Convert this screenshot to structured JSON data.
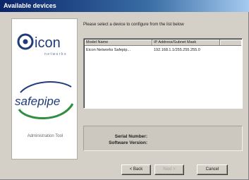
{
  "window": {
    "title": "Available devices"
  },
  "side_panel": {
    "logo_primary": {
      "text": "icon",
      "subtext": "networks"
    },
    "logo_secondary": {
      "text": "safepipe"
    },
    "footer_text": "Administration Tool"
  },
  "instruction": "Please select a device to configure from the list below",
  "device_list": {
    "columns": [
      "Model Name",
      "IP Address/Subnet Mask"
    ],
    "rows": [
      {
        "model": "Eicon Networks Safepip...",
        "ip": "192.168.1.1/255.255.255.0"
      }
    ]
  },
  "info": {
    "serial_label": "Serial Number:",
    "software_label": "Software Version:"
  },
  "buttons": {
    "back": "< Back",
    "next": "Next >",
    "cancel": "Cancel"
  },
  "colors": {
    "title_gradient_start": "#0a246a",
    "logo_blue": "#1f3b7a",
    "logo_green": "#2f8f3f"
  }
}
